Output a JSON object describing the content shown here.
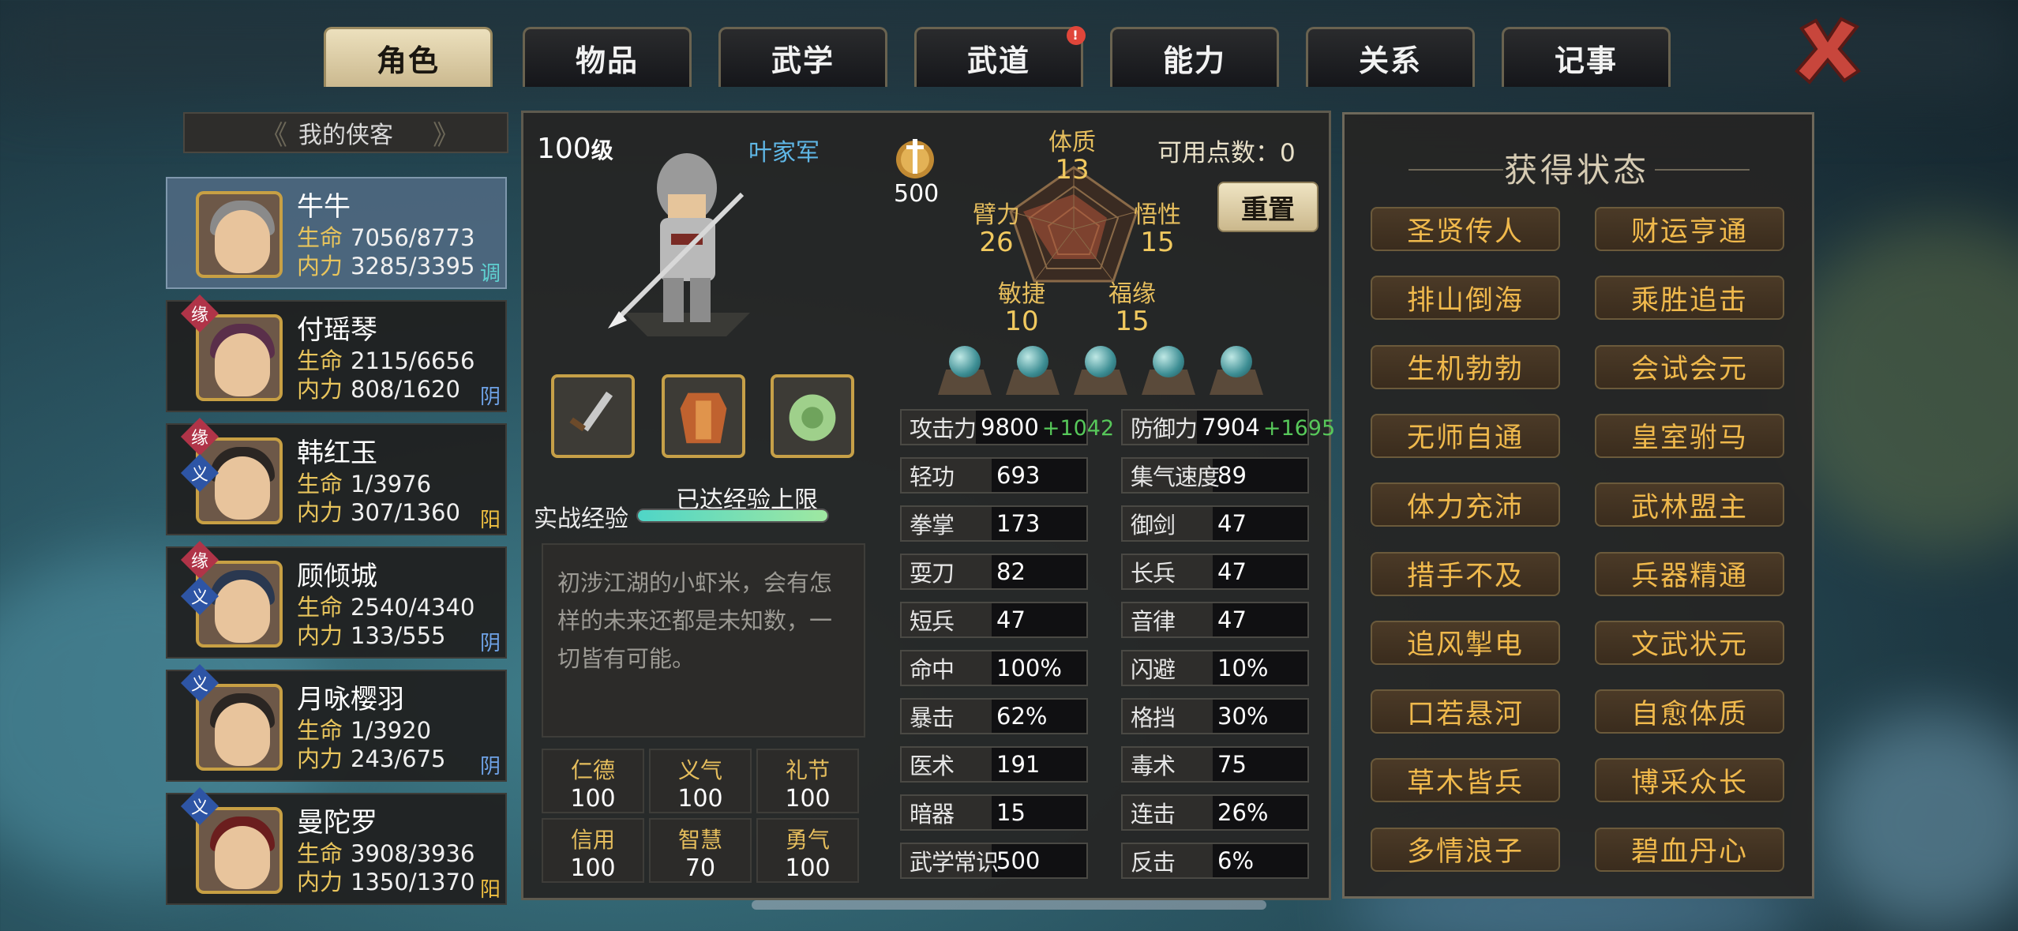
{
  "tabs": [
    {
      "label": "角色",
      "active": true
    },
    {
      "label": "物品"
    },
    {
      "label": "武学"
    },
    {
      "label": "武道",
      "alert": "!"
    },
    {
      "label": "能力"
    },
    {
      "label": "关系"
    },
    {
      "label": "记事"
    }
  ],
  "roster_title": "我的侠客",
  "characters": [
    {
      "name": "牛牛",
      "hp_label": "生命",
      "hp": "7056/8773",
      "mp_label": "内力",
      "mp": "3285/3395",
      "tag": "调",
      "tag_color": "#5fd0d0",
      "badges": []
    },
    {
      "name": "付瑶琴",
      "hp_label": "生命",
      "hp": "2115/6656",
      "mp_label": "内力",
      "mp": "808/1620",
      "tag": "阴",
      "tag_color": "#6fa3e8",
      "badges": [
        "缘"
      ]
    },
    {
      "name": "韩红玉",
      "hp_label": "生命",
      "hp": "1/3976",
      "mp_label": "内力",
      "mp": "307/1360",
      "tag": "阳",
      "tag_color": "#f0c040",
      "badges": [
        "缘",
        "义"
      ]
    },
    {
      "name": "顾倾城",
      "hp_label": "生命",
      "hp": "2540/4340",
      "mp_label": "内力",
      "mp": "133/555",
      "tag": "阴",
      "tag_color": "#6fa3e8",
      "badges": [
        "缘",
        "义"
      ]
    },
    {
      "name": "月咏樱羽",
      "hp_label": "生命",
      "hp": "1/3920",
      "mp_label": "内力",
      "mp": "243/675",
      "tag": "阴",
      "tag_color": "#6fa3e8",
      "badges": [
        "义"
      ]
    },
    {
      "name": "曼陀罗",
      "hp_label": "生命",
      "hp": "3908/3936",
      "mp_label": "内力",
      "mp": "1350/1370",
      "tag": "阳",
      "tag_color": "#f0c040",
      "badges": [
        "义"
      ]
    }
  ],
  "hero": {
    "level": "100",
    "level_unit": "级",
    "faction": "叶家军",
    "power": "500",
    "exp_label": "实战经验",
    "exp_text": "已达经验上限",
    "exp_fraction": 1.0,
    "description": "初涉江湖的小虾米，会有怎样的未来还都是未知数，一切皆有可能。"
  },
  "points_label": "可用点数：0",
  "reset_label": "重置",
  "attributes": [
    {
      "name": "体质",
      "value": "13"
    },
    {
      "name": "悟性",
      "value": "15"
    },
    {
      "name": "福缘",
      "value": "15"
    },
    {
      "name": "敏捷",
      "value": "10"
    },
    {
      "name": "臂力",
      "value": "26"
    }
  ],
  "virtues": [
    {
      "name": "仁德",
      "value": "100"
    },
    {
      "name": "义气",
      "value": "100"
    },
    {
      "name": "礼节",
      "value": "100"
    },
    {
      "name": "信用",
      "value": "100"
    },
    {
      "name": "智慧",
      "value": "70"
    },
    {
      "name": "勇气",
      "value": "100"
    }
  ],
  "stats_left": [
    {
      "label": "攻击力",
      "value": "9800",
      "bonus": "+1042"
    },
    {
      "label": "轻功",
      "value": "693"
    },
    {
      "label": "拳掌",
      "value": "173"
    },
    {
      "label": "耍刀",
      "value": "82"
    },
    {
      "label": "短兵",
      "value": "47"
    },
    {
      "label": "命中",
      "value": "100%"
    },
    {
      "label": "暴击",
      "value": "62%"
    },
    {
      "label": "医术",
      "value": "191"
    },
    {
      "label": "暗器",
      "value": "15"
    },
    {
      "label": "武学常识",
      "value": "500"
    }
  ],
  "stats_right": [
    {
      "label": "防御力",
      "value": "7904",
      "bonus": "+1695"
    },
    {
      "label": "集气速度",
      "value": "89"
    },
    {
      "label": "御剑",
      "value": "47"
    },
    {
      "label": "长兵",
      "value": "47"
    },
    {
      "label": "音律",
      "value": "47"
    },
    {
      "label": "闪避",
      "value": "10%"
    },
    {
      "label": "格挡",
      "value": "30%"
    },
    {
      "label": "毒术",
      "value": "75"
    },
    {
      "label": "连击",
      "value": "26%"
    },
    {
      "label": "反击",
      "value": "6%"
    }
  ],
  "status_title": "获得状态",
  "statuses": [
    "圣贤传人",
    "财运亨通",
    "排山倒海",
    "乘胜追击",
    "生机勃勃",
    "会试会元",
    "无师自通",
    "皇室驸马",
    "体力充沛",
    "武林盟主",
    "措手不及",
    "兵器精通",
    "追风掣电",
    "文武状元",
    "口若悬河",
    "自愈体质",
    "草木皆兵",
    "博采众长",
    "多情浪子",
    "碧血丹心"
  ],
  "colors": {
    "gold": "#e6be5d",
    "bonus": "#57c85a",
    "status_text": "#f0b94c"
  }
}
